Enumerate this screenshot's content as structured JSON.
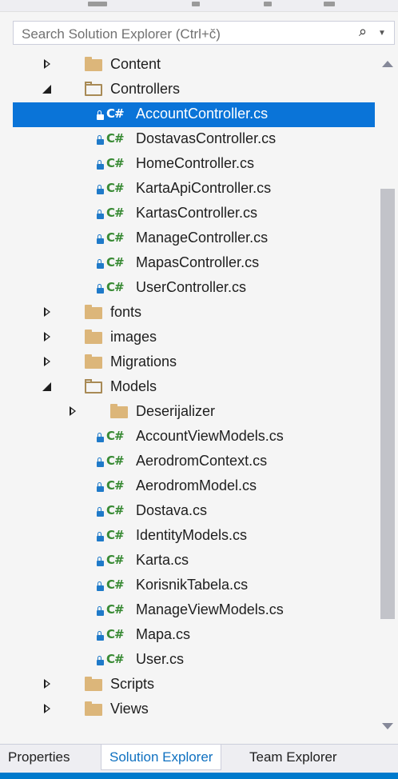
{
  "search": {
    "placeholder": "Search Solution Explorer (Ctrl+č)"
  },
  "tree": {
    "folders": {
      "content": "Content",
      "controllers": "Controllers",
      "fonts": "fonts",
      "images": "images",
      "migrations": "Migrations",
      "models": "Models",
      "deserijalizer": "Deserijalizer",
      "scripts": "Scripts",
      "views": "Views"
    },
    "controllers_files": [
      "AccountController.cs",
      "DostavasController.cs",
      "HomeController.cs",
      "KartaApiController.cs",
      "KartasController.cs",
      "ManageController.cs",
      "MapasController.cs",
      "UserController.cs"
    ],
    "models_files": [
      "AccountViewModels.cs",
      "AerodromContext.cs",
      "AerodromModel.cs",
      "Dostava.cs",
      "IdentityModels.cs",
      "Karta.cs",
      "KorisnikTabela.cs",
      "ManageViewModels.cs",
      "Mapa.cs",
      "User.cs"
    ],
    "selected_file": "AccountController.cs",
    "cs_badge": "C#"
  },
  "tabs": {
    "properties": "Properties",
    "solution_explorer": "Solution Explorer",
    "team_explorer": "Team Explorer",
    "active": "Solution Explorer"
  },
  "colors": {
    "selection": "#0a74d8",
    "accent": "#007acc",
    "folder": "#dcb67a",
    "csharp": "#388a34"
  }
}
